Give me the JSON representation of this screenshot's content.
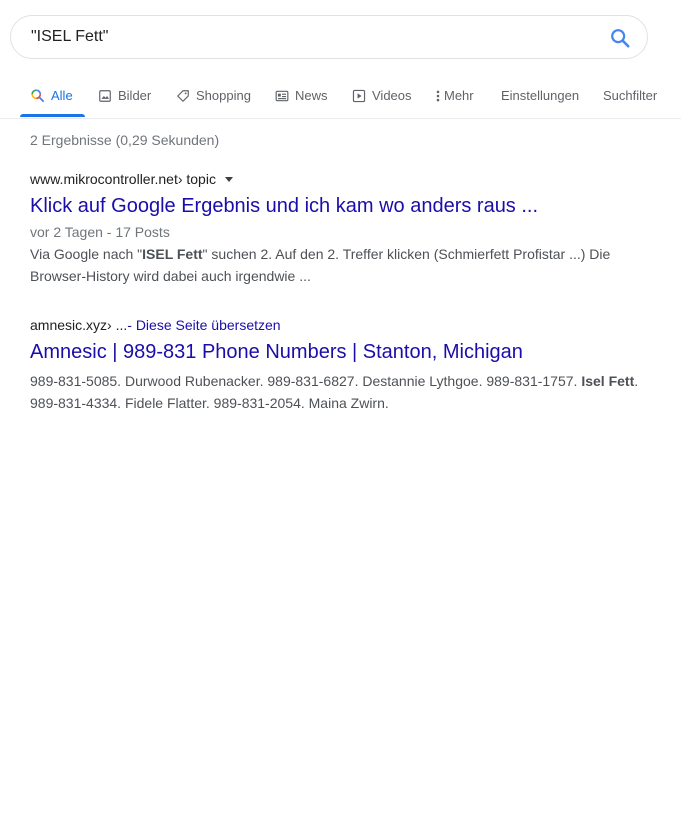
{
  "search": {
    "query": "\"ISEL Fett\""
  },
  "tabs": [
    {
      "label": "Alle",
      "icon": "search-icon"
    },
    {
      "label": "Bilder",
      "icon": "image-icon"
    },
    {
      "label": "Shopping",
      "icon": "tag-icon"
    },
    {
      "label": "News",
      "icon": "news-icon"
    },
    {
      "label": "Videos",
      "icon": "play-icon"
    },
    {
      "label": "Mehr",
      "icon": "more-vert-icon"
    },
    {
      "label": "Einstellungen"
    },
    {
      "label": "Suchfilter"
    }
  ],
  "stats": "2 Ergebnisse (0,29 Sekunden)",
  "results": [
    {
      "domain": "www.mikrocontroller.net",
      "path": " › topic",
      "title": "Klick auf Google Ergebnis und ich kam wo anders raus ...",
      "meta": "vor 2 Tagen - 17 Posts",
      "snippet_parts": [
        "Via Google nach \"",
        "ISEL Fett",
        "\" suchen 2. Auf den 2. Treffer klicken (Schmierfett Profistar ...) Die Browser-History wird dabei auch irgendwie ..."
      ]
    },
    {
      "domain": "amnesic.xyz",
      "path": " › ... ",
      "translate_text": "- Diese Seite übersetzen",
      "title": "Amnesic | 989-831 Phone Numbers | Stanton, Michigan",
      "snippet_parts": [
        "989-831-5085. Durwood Rubenacker. 989-831-6827. Destannie Lythgoe. 989-831-1757. ",
        "Isel Fett",
        ". 989-831-4334. Fidele Flatter. 989-831-2054. Maina Zwirn."
      ]
    }
  ],
  "colors": {
    "link": "#1a0dab",
    "accent": "#1a73e8",
    "muted": "#70757a",
    "snippet": "#4d5156"
  }
}
